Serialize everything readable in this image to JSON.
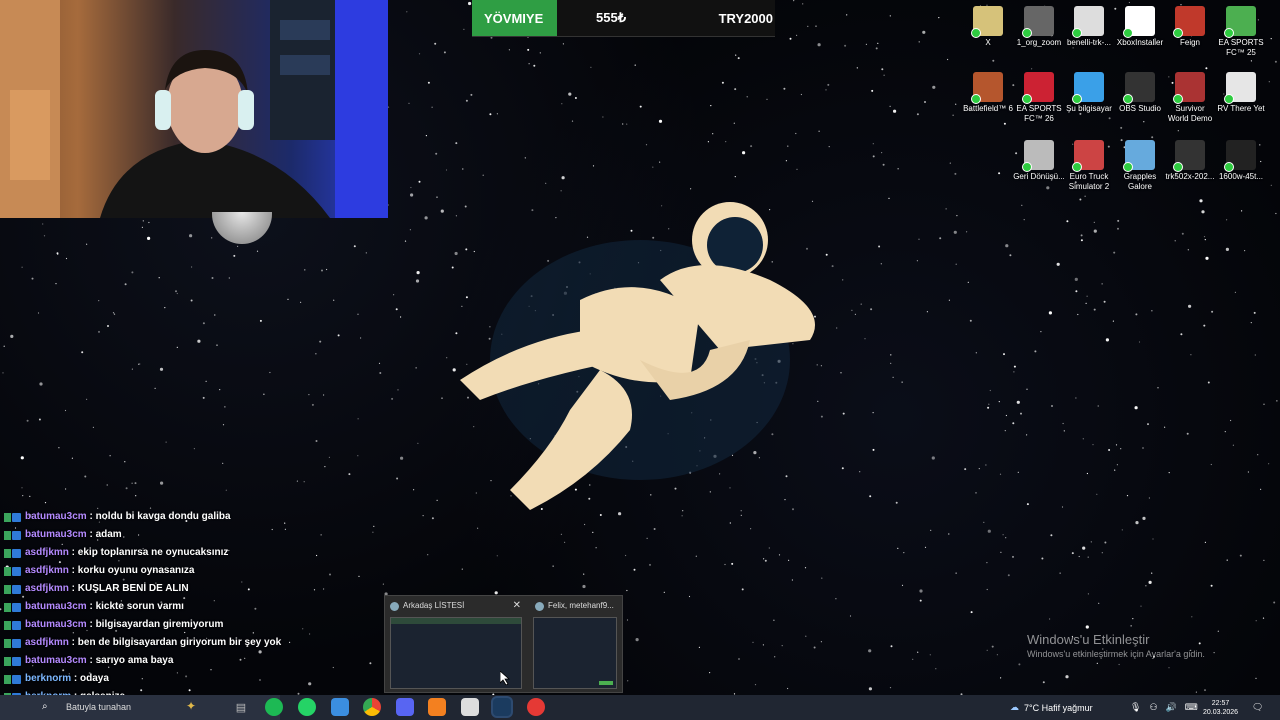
{
  "scorebar": {
    "label": "YÖVMIYE",
    "value1": "555₺",
    "value2": "TRY2000"
  },
  "desktop_icons": [
    {
      "name": "X",
      "color": "#d6c27a"
    },
    {
      "name": "1_org_zoom",
      "color": "#666"
    },
    {
      "name": "benelli-trk-...",
      "color": "#ddd"
    },
    {
      "name": "XboxInstaller",
      "color": "#fff"
    },
    {
      "name": "Feign",
      "color": "#c0392b"
    },
    {
      "name": "EA SPORTS FC™ 25",
      "color": "#4caf50"
    },
    {
      "name": "Battlefield™ 6",
      "color": "#b5562d"
    },
    {
      "name": "EA SPORTS FC™ 26",
      "color": "#c23"
    },
    {
      "name": "Şu bilgisayar",
      "color": "#3aa0e8"
    },
    {
      "name": "OBS Studio",
      "color": "#333"
    },
    {
      "name": "Survivor World Demo",
      "color": "#a33"
    },
    {
      "name": "RV There Yet",
      "color": "#e6e6e6"
    },
    {
      "name": "Geri Dönüşü...",
      "color": "#bbb"
    },
    {
      "name": "Euro Truck Simulator 2",
      "color": "#c44"
    },
    {
      "name": "Grapples Galore",
      "color": "#6ad"
    },
    {
      "name": "trk502x-202...",
      "color": "#333"
    },
    {
      "name": "1600w-45t...",
      "color": "#222"
    }
  ],
  "chat": [
    {
      "user": "batumau3cm",
      "msg": "noldu bi kavga dondu galiba",
      "color": "purple"
    },
    {
      "user": "batumau3cm",
      "msg": "adam",
      "color": "purple"
    },
    {
      "user": "asdfjkmn",
      "msg": "ekip toplanırsa ne oynucaksınız",
      "color": "purple"
    },
    {
      "user": "asdfjkmn",
      "msg": "korku oyunu oynasanıza",
      "color": "purple"
    },
    {
      "user": "asdfjkmn",
      "msg": "KUŞLAR BENİ DE ALIN",
      "color": "purple"
    },
    {
      "user": "batumau3cm",
      "msg": "kickte sorun varmı",
      "color": "purple"
    },
    {
      "user": "batumau3cm",
      "msg": "bilgisayardan giremiyorum",
      "color": "purple"
    },
    {
      "user": "asdfjkmn",
      "msg": "ben de bilgisayardan giriyorum bir şey yok",
      "color": "purple"
    },
    {
      "user": "batumau3cm",
      "msg": "sarıyo ama baya",
      "color": "purple"
    },
    {
      "user": "berknorm",
      "msg": "odaya",
      "color": "blue"
    },
    {
      "user": "berknorm",
      "msg": "gelsenize",
      "color": "blue"
    }
  ],
  "thumbs": [
    {
      "title": "Arkadaş LİSTESİ"
    },
    {
      "title": "Felix, metehanf9..."
    }
  ],
  "activate": {
    "title": "Windows'u Etkinleştir",
    "sub": "Windows'u etkinleştirmek için Ayarlar'a gidin."
  },
  "taskbar": {
    "search_text": "Batuyla tunahan",
    "weather": "7°C  Hafif yağmur",
    "time": "22:57",
    "date": "20.03.2026"
  }
}
